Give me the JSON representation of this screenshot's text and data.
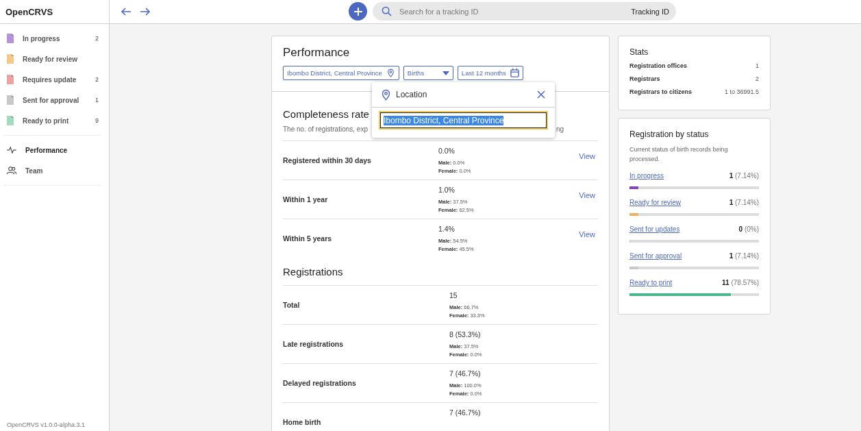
{
  "app": {
    "title": "OpenCRVS",
    "version": "OpenCRVS v1.0.0-alpha.3.1"
  },
  "sidebar": {
    "items": [
      {
        "kind": "queue",
        "label": "In progress",
        "count": "2",
        "color": "#b794d9",
        "selected": false
      },
      {
        "kind": "queue",
        "label": "Ready for review",
        "color": "#f5c98a",
        "selected": false
      },
      {
        "kind": "queue",
        "label": "Requires update",
        "count": "2",
        "color": "#eea3a3",
        "selected": false
      },
      {
        "kind": "queue",
        "label": "Sent for approval",
        "count": "1",
        "color": "#c8c8c8",
        "selected": false
      },
      {
        "kind": "queue",
        "label": "Ready to print",
        "count": "9",
        "color": "#a3dcc0",
        "selected": false
      },
      {
        "kind": "performance",
        "label": "Performance",
        "selected": true
      },
      {
        "kind": "team",
        "label": "Team",
        "selected": false
      }
    ]
  },
  "top_bar": {
    "search": {
      "placeholder": "Search for a tracking ID",
      "type_label": "Tracking ID"
    }
  },
  "performance": {
    "title": "Performance",
    "filters": [
      {
        "kind": "location",
        "label": "Ibombo District, Central Province"
      },
      {
        "kind": "dropdown",
        "label": "Births"
      },
      {
        "kind": "date",
        "label": "Last 12 months"
      }
    ],
    "completeness": {
      "title": "Completeness rate",
      "description_start": "The no. of registrations, exp",
      "description_end": "ng",
      "rows": [
        {
          "label": "Registered within 30 days",
          "value": "0.0%",
          "male": "**Male:** 0.0%",
          "female": "**Female:** 0.0%",
          "link": "View"
        },
        {
          "label": "Within 1 year",
          "value": "1.0%",
          "male": "**Male:** 37.5%",
          "female": "**Female:** 62.5%",
          "link": "View"
        },
        {
          "label": "Within 5 years",
          "value": "1.4%",
          "male": "**Male:** 54.5%",
          "female": "**Female:** 45.5%",
          "link": "View"
        }
      ]
    },
    "registrations": {
      "title": "Registrations",
      "rows": [
        {
          "label": "Total",
          "value": "15",
          "male": "**Male:** 66.7%",
          "female": "**Female:** 33.3%"
        },
        {
          "label": "Late registrations",
          "value": "8 (53.3%)",
          "male": "**Male:** 37.5%",
          "female": "**Female:** 0.0%"
        },
        {
          "label": "Delayed registrations",
          "value": "7 (46.7%)",
          "male": "**Male:** 100.0%",
          "female": "**Female:** 0.0%"
        },
        {
          "label": "Home birth",
          "value": "7 (46.7%)"
        }
      ]
    }
  },
  "location_popup": {
    "title": "Location",
    "value": "Ibombo District, Central Province"
  },
  "stats": {
    "title": "Stats",
    "rows": [
      {
        "label": "Registration offices",
        "value": "1"
      },
      {
        "label": "Registrars",
        "value": "2"
      },
      {
        "label": "Registrars to citizens",
        "value": "1 to 36991.5"
      }
    ]
  },
  "status": {
    "title": "Registration by status",
    "description": "Current status of birth records being processed.",
    "rows": [
      {
        "label": "In progress",
        "count": "1",
        "percent": "(7.14%)",
        "level": 0.0714,
        "color": "#8049b7"
      },
      {
        "label": "Ready for review",
        "count": "1",
        "percent": "(7.14%)",
        "level": 0.0714,
        "color": "#f1b162"
      },
      {
        "label": "Sent for updates",
        "count": "0",
        "percent": "(0%)",
        "level": 0
      },
      {
        "label": "Sent for approval",
        "count": "1",
        "percent": "(7.14%)",
        "level": 0.0714,
        "color": "#c8c8c8"
      },
      {
        "label": "Ready to print",
        "count": "11",
        "percent": "(78.57%)",
        "level": 0.7857,
        "color": "#49b78d"
      }
    ]
  }
}
